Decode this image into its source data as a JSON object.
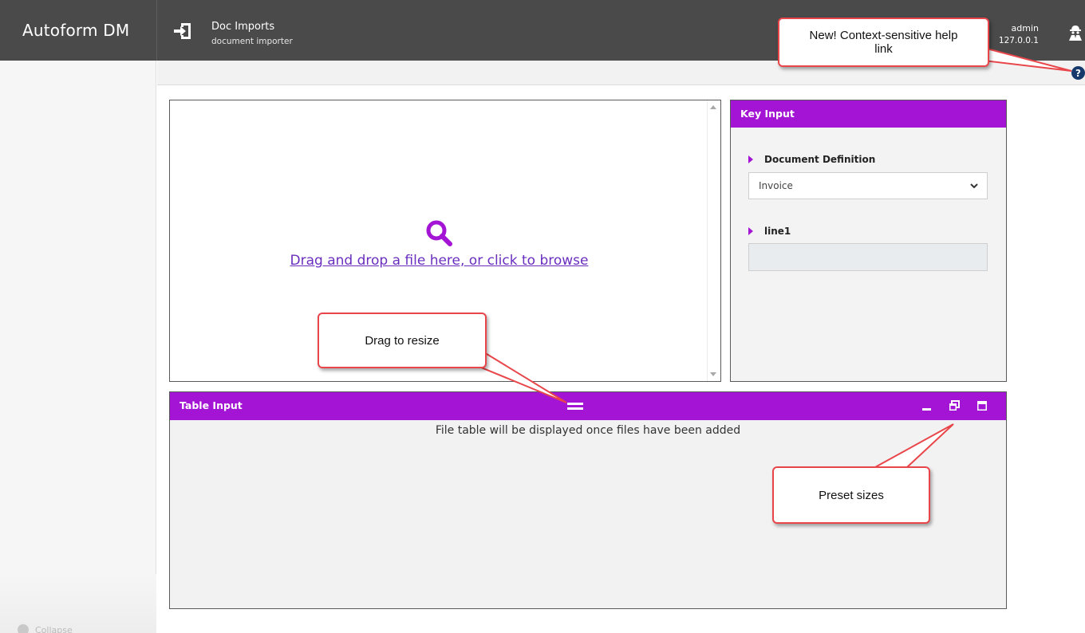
{
  "app": {
    "brand": "Autoform DM"
  },
  "module": {
    "title": "Doc Imports",
    "subtitle": "document importer",
    "icon": "import-icon"
  },
  "user": {
    "name": "admin",
    "ip": "127.0.0.1",
    "icon": "user-icon"
  },
  "help": {
    "glyph": "?",
    "icon": "help-icon"
  },
  "dropzone": {
    "icon": "search-icon",
    "link_text": "Drag and drop a file here, or click to browse"
  },
  "key_input": {
    "title": "Key Input",
    "fields": [
      {
        "label": "Document Definition",
        "type": "select",
        "value": "Invoice"
      },
      {
        "label": "line1",
        "type": "text",
        "value": ""
      }
    ]
  },
  "table_input": {
    "title": "Table Input",
    "empty_message": "File table will be displayed once files have been added",
    "controls": [
      "minimize-icon",
      "restore-icon",
      "maximize-icon"
    ]
  },
  "sidebar": {
    "collapse_label": "Collapse"
  },
  "callouts": {
    "help": "New! Context-sensitive help link",
    "resize": "Drag to resize",
    "preset": "Preset sizes"
  },
  "colors": {
    "accent": "#a314d4",
    "header": "#4a4a4a",
    "link": "#6a2ebf",
    "callout_border": "#e8464a",
    "help": "#153a6b"
  }
}
